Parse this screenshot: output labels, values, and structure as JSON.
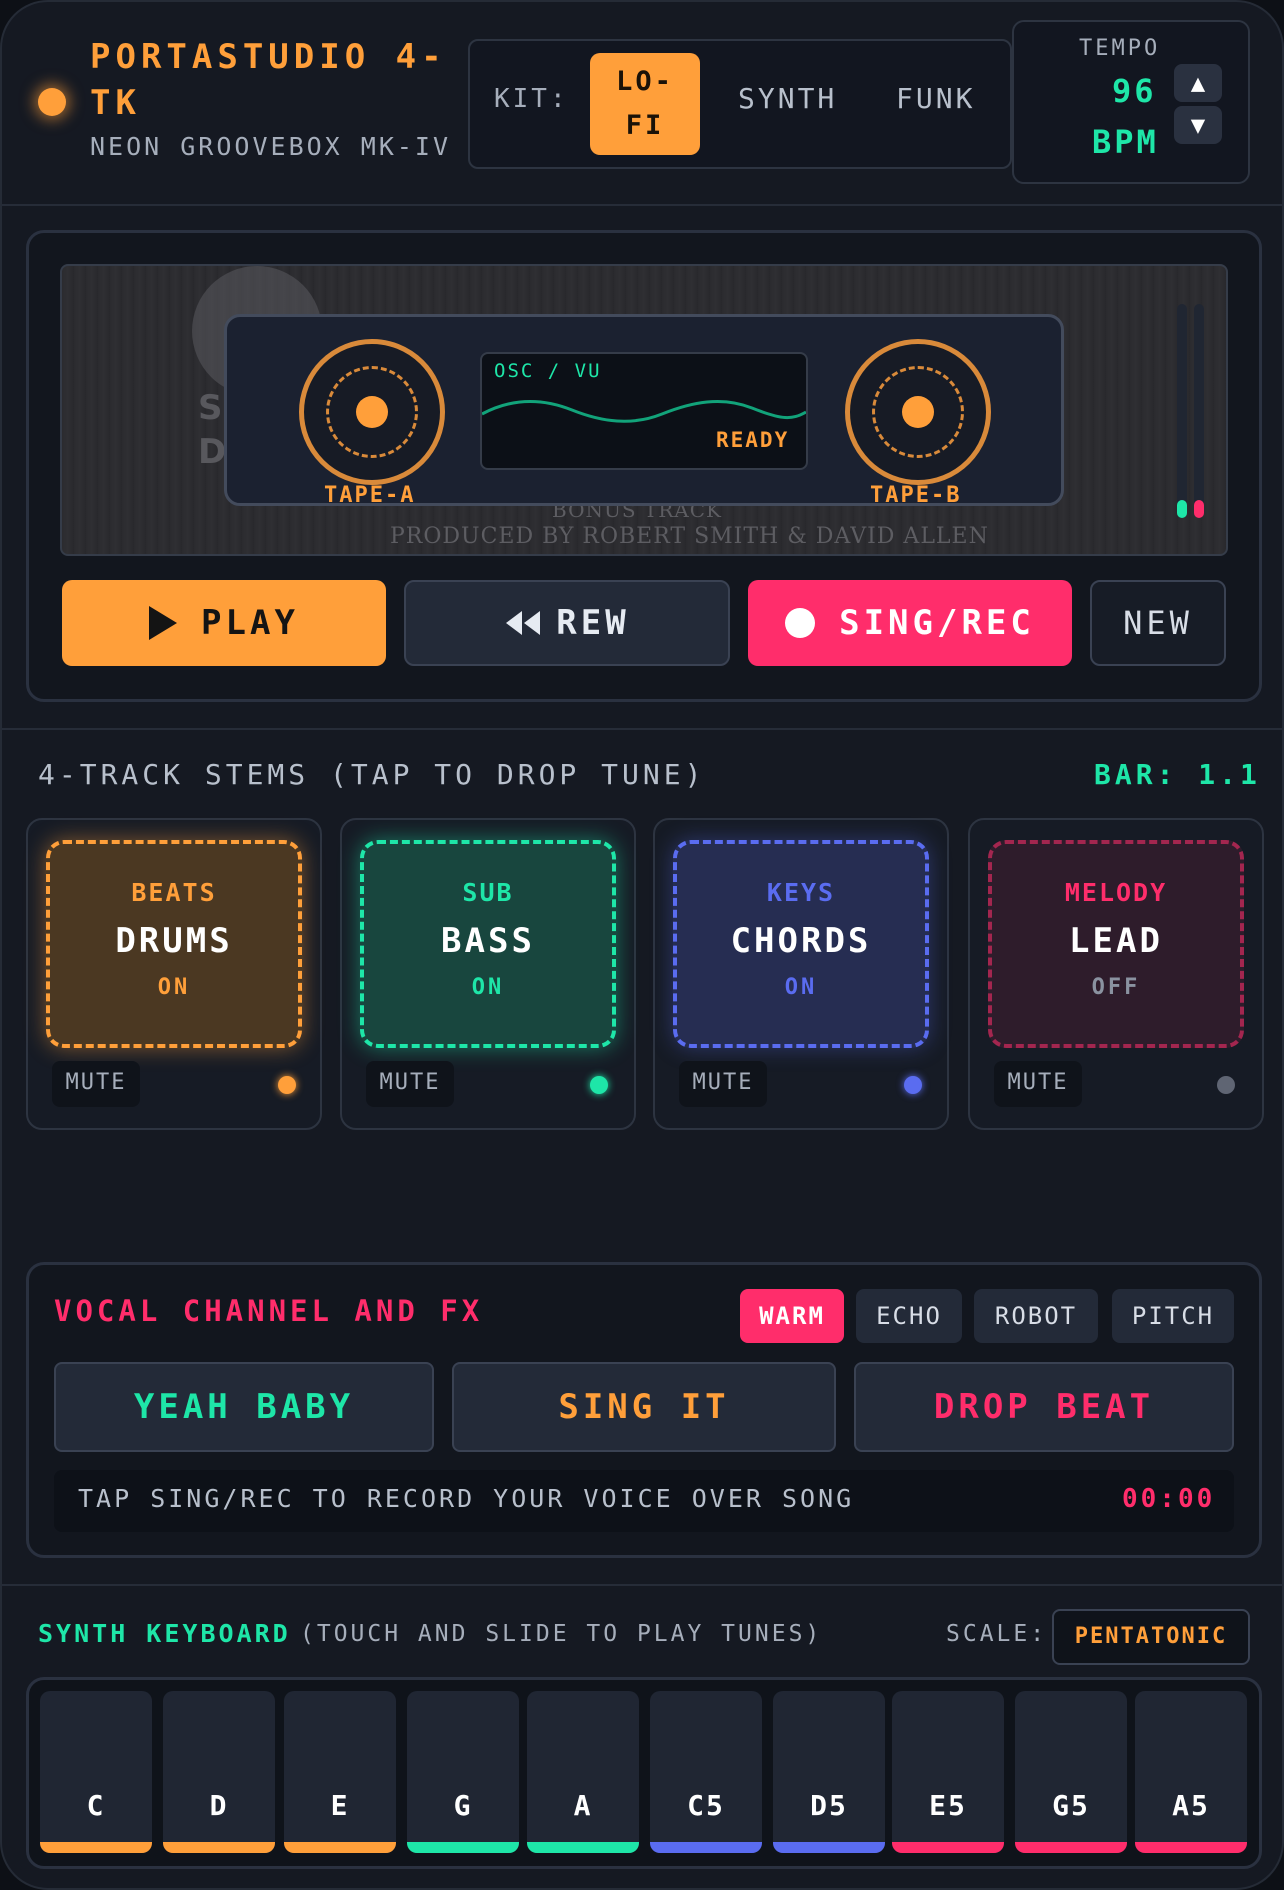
{
  "header": {
    "title": "PORTASTUDIO 4-TK",
    "subtitle": "NEON GROOVEBOX MK-IV",
    "kit_label": "KIT:",
    "kits": [
      "LO-FI",
      "SYNTH",
      "FUNK"
    ],
    "kit_selected": "LO-FI",
    "tempo_label": "TEMPO",
    "tempo_value": "96",
    "tempo_unit": "BPM",
    "tempo_up_icon": "▲",
    "tempo_down_icon": "▼"
  },
  "deck": {
    "art_lines": [
      "BONUS TRACK",
      "PRODUCED BY ROBERT SMITH & DAVID ALLEN"
    ],
    "tape_a": "TAPE-A",
    "tape_b": "TAPE-B",
    "osc_label": "OSC / VU",
    "osc_status": "READY",
    "transport": {
      "play": "PLAY",
      "rew": "REW",
      "rec": "SING/REC",
      "new": "NEW"
    }
  },
  "stems": {
    "title": "4-TRACK STEMS (TAP TO DROP TUNE)",
    "bar": "BAR: 1.1",
    "tracks": [
      {
        "category": "BEATS",
        "name": "DRUMS",
        "state": "ON",
        "mute": "MUTE",
        "color": "#ff9f3a"
      },
      {
        "category": "SUB",
        "name": "BASS",
        "state": "ON",
        "mute": "MUTE",
        "color": "#1ee6a8"
      },
      {
        "category": "KEYS",
        "name": "CHORDS",
        "state": "ON",
        "mute": "MUTE",
        "color": "#5a6cf0"
      },
      {
        "category": "MELODY",
        "name": "LEAD",
        "state": "OFF",
        "mute": "MUTE",
        "color": "#ff2d6b"
      }
    ]
  },
  "vocal": {
    "title": "VOCAL CHANNEL AND FX",
    "fx": [
      "WARM",
      "ECHO",
      "ROBOT",
      "PITCH"
    ],
    "fx_selected": "WARM",
    "phrases": [
      "YEAH BABY",
      "SING IT",
      "DROP BEAT"
    ],
    "hint": "TAP SING/REC TO RECORD YOUR VOICE OVER SONG",
    "time": "00:00"
  },
  "keyboard": {
    "title": "SYNTH KEYBOARD",
    "subtitle": "(TOUCH AND SLIDE TO PLAY TUNES)",
    "scale_label": "SCALE:",
    "scale_value": "PENTATONIC",
    "keys": [
      "C",
      "D",
      "E",
      "G",
      "A",
      "C5",
      "D5",
      "E5",
      "G5",
      "A5"
    ]
  },
  "colors": {
    "accent_orange": "#ff9f3a",
    "accent_green": "#1ee6a8",
    "accent_blue": "#5a6cf0",
    "accent_pink": "#ff2d6b"
  },
  "icons": {
    "play": "play-icon",
    "rew": "rewind-icon",
    "rec": "record-dot-icon"
  }
}
